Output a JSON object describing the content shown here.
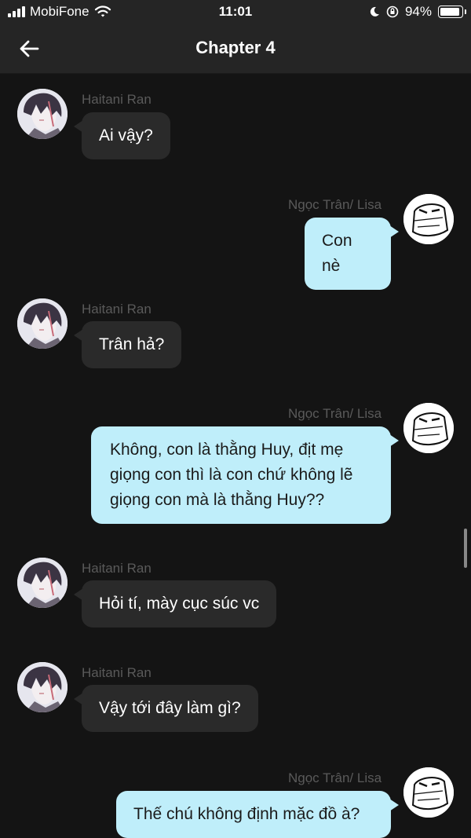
{
  "status_bar": {
    "carrier": "MobiFone",
    "time": "11:01",
    "battery": "94%",
    "battery_level": 0.94
  },
  "header": {
    "title": "Chapter 4"
  },
  "messages": [
    {
      "sender": "Haitani Ran",
      "side": "left",
      "text": "Ai vậy?"
    },
    {
      "sender": "Ngọc Trân/ Lisa",
      "side": "right",
      "text": "Con nè"
    },
    {
      "sender": "Haitani Ran",
      "side": "left",
      "text": "Trân hả?"
    },
    {
      "sender": "Ngọc Trân/ Lisa",
      "side": "right",
      "lines": [
        "Không, con là thằng Huy, địt mẹ",
        "giọng con thì là con chứ không lẽ",
        "giọng con mà là thằng Huy??"
      ]
    },
    {
      "sender": "Haitani Ran",
      "side": "left",
      "text": "Hỏi tí, mày cục súc vc"
    },
    {
      "sender": "Haitani Ran",
      "side": "left",
      "text": "Vậy tới đây làm gì?"
    },
    {
      "sender": "Ngọc Trân/ Lisa",
      "side": "right",
      "text": "Thế chú không định mặc đồ à?"
    }
  ],
  "colors": {
    "background": "#141414",
    "incoming_bubble": "#2a2a2a",
    "outgoing_bubble": "#bfeefa"
  }
}
